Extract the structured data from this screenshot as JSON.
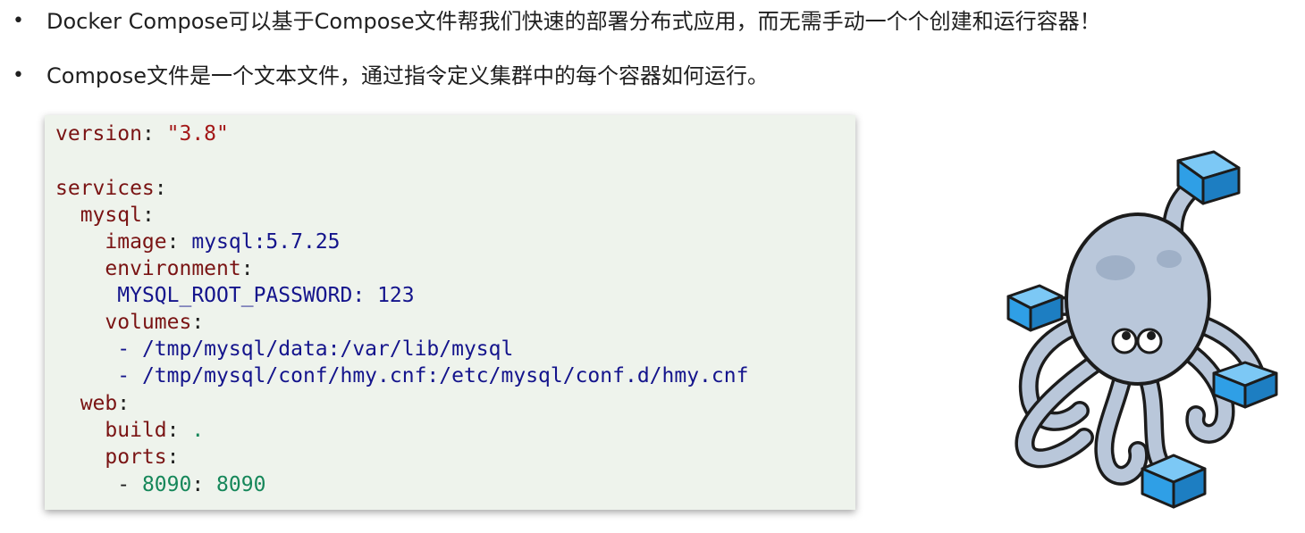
{
  "bullets": [
    "Docker Compose可以基于Compose文件帮我们快速的部署分布式应用，而无需手动一个个创建和运行容器！",
    "Compose文件是一个文本文件，通过指令定义集群中的每个容器如何运行。"
  ],
  "bullet_symbol": "•",
  "code": {
    "version_key": "version",
    "version_value": "\"3.8\"",
    "services_key": "services",
    "mysql_key": "mysql",
    "image_key": "image",
    "image_value": "mysql:5.7.25",
    "environment_key": "environment",
    "env_var_key": "MYSQL_ROOT_PASSWORD",
    "env_var_value": "123",
    "volumes_key": "volumes",
    "volume_1": "/tmp/mysql/data:/var/lib/mysql",
    "volume_2": "/tmp/mysql/conf/hmy.cnf:/etc/mysql/conf.d/hmy.cnf",
    "web_key": "web",
    "build_key": "build",
    "build_value": ".",
    "ports_key": "ports",
    "port_host": "8090",
    "port_container": "8090"
  },
  "colors": {
    "code_bg": "#eef3ec",
    "key": "#7a1414",
    "string": "#a31818",
    "value": "#14148c",
    "number": "#16875a",
    "container_blue": "#2f9fe6",
    "octopus_body": "#b9c7da"
  },
  "illustration": {
    "icon": "docker-compose-octopus"
  }
}
